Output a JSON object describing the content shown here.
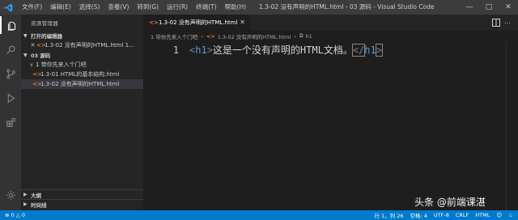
{
  "menu": [
    "文件(F)",
    "编辑(E)",
    "选择(S)",
    "查看(V)",
    "转到(G)",
    "运行(R)",
    "终端(T)",
    "帮助(H)"
  ],
  "window_title": "1.3-02 没有声明的HTML.html - 03 源码 - Visual Studio Code",
  "sidebar": {
    "title": "资源管理器",
    "open_editors_label": "打开的编辑器",
    "open_file": "1.3-02 没有声明的HTML.html 1...",
    "workspace_label": "03 源码",
    "folder": "1 带你先来入个门吧",
    "files": [
      "1.3-01 HTML的基本结构.html",
      "1.3-02 没有声明的HTML.html"
    ],
    "outline_label": "大纲",
    "timeline_label": "时间线"
  },
  "tab": {
    "label": "1.3-02 没有声明的HTML.html"
  },
  "breadcrumb": {
    "folder": "1 带你先来入个门吧",
    "file": "1.3-02 没有声明的HTML.html",
    "symbol": "h1"
  },
  "code": {
    "line_number": "1",
    "open_bracket": "<",
    "open_tag": "h1",
    "close_bracket": ">",
    "text": "这是一个没有声明的HTML文档。",
    "close_open": "</",
    "close_tag": "h1",
    "close_end": ">"
  },
  "status": {
    "errors": "0",
    "warnings": "0",
    "position": "行 1，列 26",
    "indent": "空格: 4",
    "encoding": "UTF-8",
    "eol": "CRLF",
    "language": "HTML"
  },
  "watermark": "头条 @前端课湛",
  "colors": {
    "accent": "#007acc",
    "tag": "#569cd6",
    "html_icon": "#e37933"
  }
}
